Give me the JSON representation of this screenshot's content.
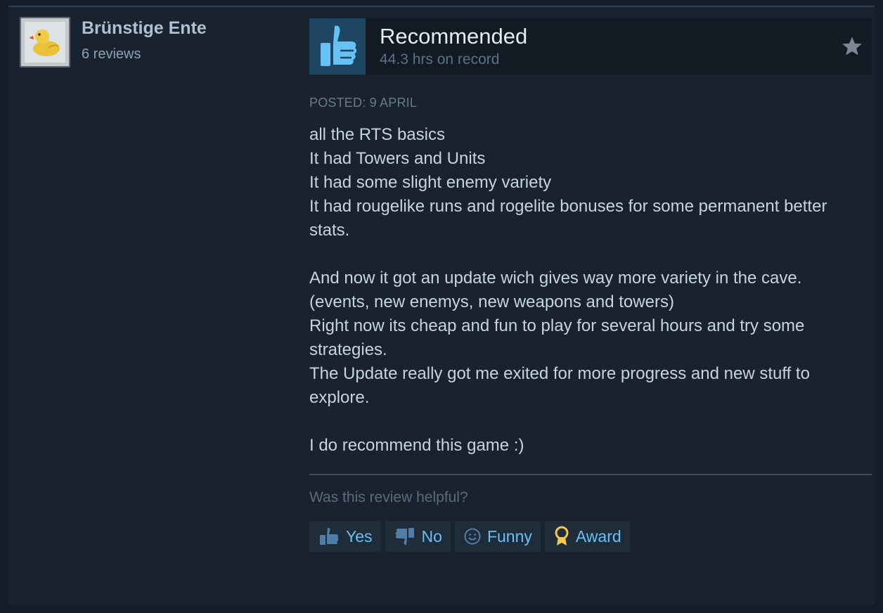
{
  "reviewer": {
    "name": "Brünstige Ente",
    "review_count": "6 reviews",
    "avatar_icon": "rubber-duck-icon"
  },
  "review": {
    "verdict": "Recommended",
    "hours": "44.3 hrs on record",
    "posted": "POSTED: 9 APRIL",
    "paragraphs": [
      "all the RTS basics\nIt had Towers and Units\nIt had some slight enemy variety\nIt had rougelike runs and rogelite bonuses for some permanent better stats.",
      "And now it got an update wich gives way more variety in the cave. (events, new enemys, new weapons and towers)\nRight now its cheap and fun to play for several hours and try some strategies.\nThe Update really got me exited for more progress and new stuff to explore.",
      "I do recommend this game :)"
    ]
  },
  "feedback": {
    "prompt": "Was this review helpful?",
    "buttons": {
      "yes": "Yes",
      "no": "No",
      "funny": "Funny",
      "award": "Award"
    }
  },
  "colors": {
    "accent": "#66c0f4",
    "background": "#19222f",
    "banner": "#121a24",
    "thumb_box": "#1e4561"
  }
}
